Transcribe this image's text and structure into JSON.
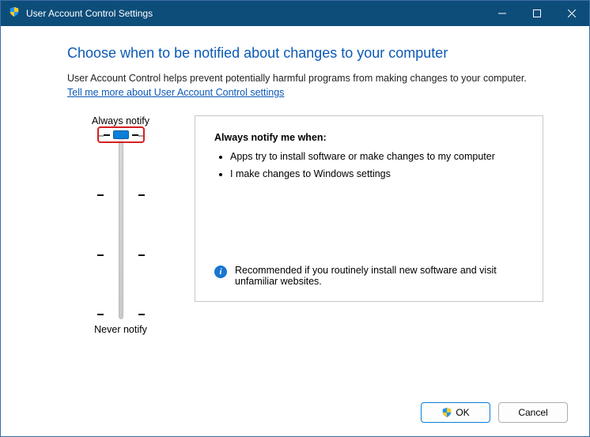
{
  "titlebar": {
    "title": "User Account Control Settings"
  },
  "heading": "Choose when to be notified about changes to your computer",
  "description": "User Account Control helps prevent potentially harmful programs from making changes to your computer.",
  "link": "Tell me more about User Account Control settings",
  "slider": {
    "top_label": "Always notify",
    "bottom_label": "Never notify",
    "position": 0,
    "levels": 4
  },
  "info": {
    "title": "Always notify me when:",
    "bullets": [
      "Apps try to install software or make changes to my computer",
      "I make changes to Windows settings"
    ],
    "recommendation": "Recommended if you routinely install new software and visit unfamiliar websites."
  },
  "buttons": {
    "ok": "OK",
    "cancel": "Cancel"
  }
}
